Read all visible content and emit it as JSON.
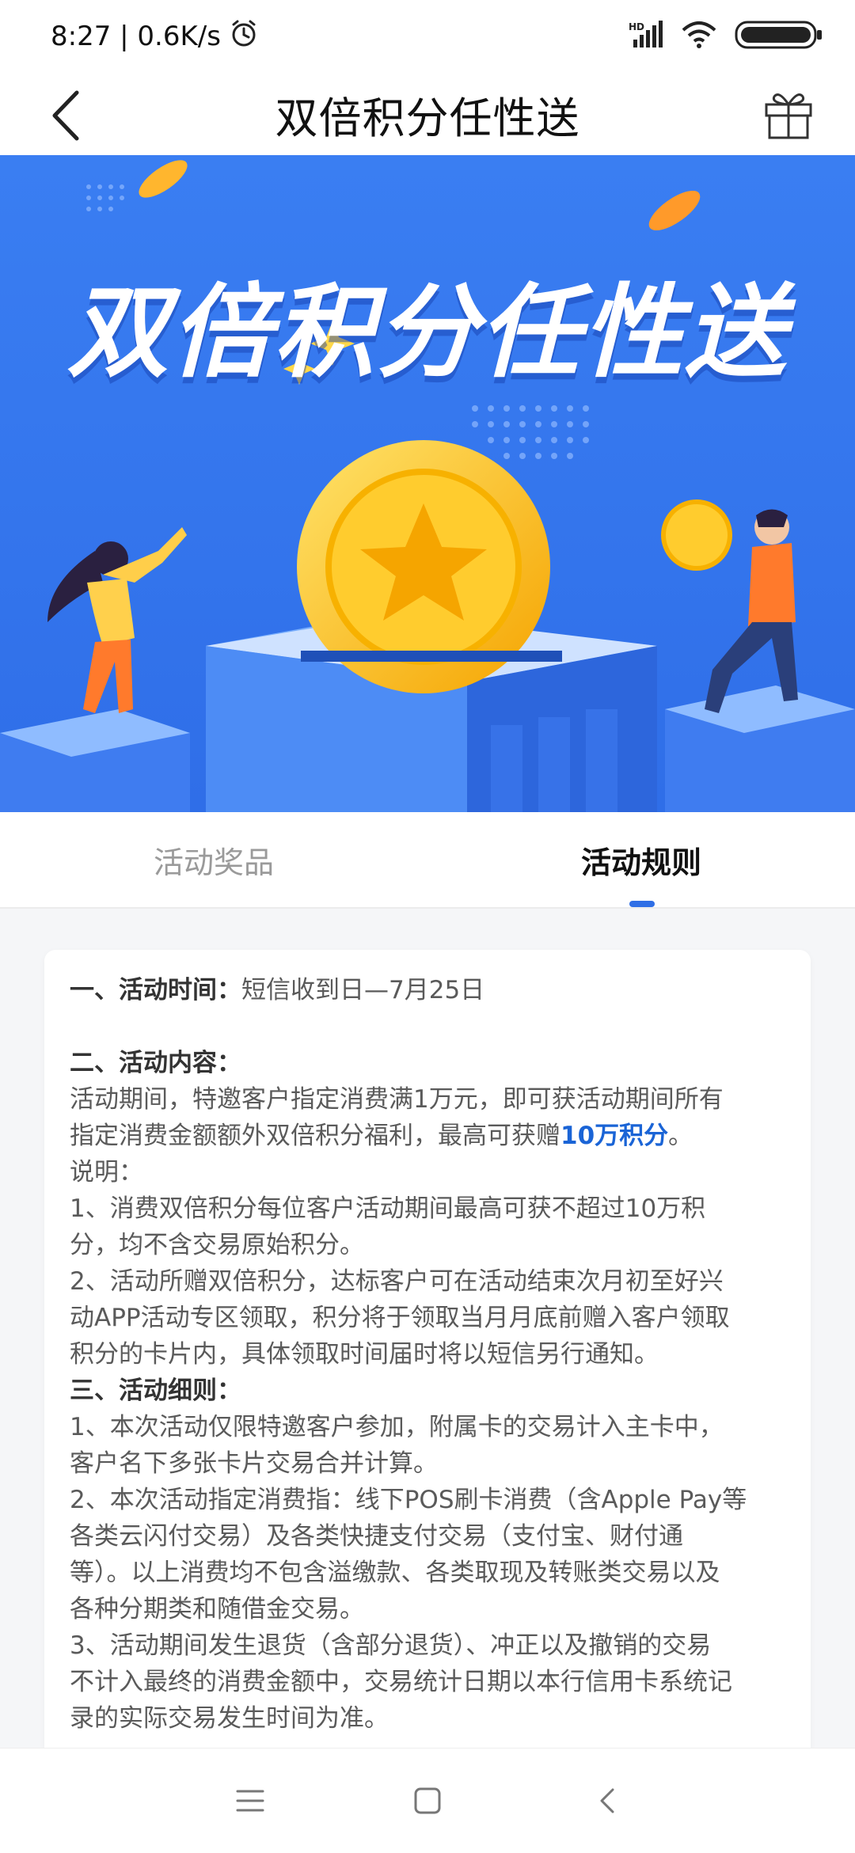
{
  "status": {
    "time_speed": "8:27 | 0.6K/s",
    "icons": [
      "alarm-icon",
      "signal-hd-icon",
      "wifi-icon",
      "battery-icon"
    ]
  },
  "nav": {
    "title": "双倍积分任性送",
    "back_icon": "chevron-left-icon",
    "gift_icon": "gift-icon"
  },
  "banner": {
    "title": "双倍积分任性送"
  },
  "tabs": [
    {
      "label": "活动奖品",
      "active": false
    },
    {
      "label": "活动规则",
      "active": true
    }
  ],
  "rules": {
    "time_head": "一、活动时间：",
    "time_value": "短信收到日—7月25日",
    "content_head": "二、活动内容：",
    "content_line1": "活动期间，特邀客户指定消费满1万元，即可获活动期间所有",
    "content_line2_prefix": "指定消费金额额外双倍积分福利，最高可获赠",
    "content_highlight": "10万积分",
    "content_line2_suffix": "。",
    "note_label": "说明：",
    "note1_line1": "1、消费双倍积分每位客户活动期间最高可获不超过10万积",
    "note1_line2": "分，均不含交易原始积分。",
    "note2_line1": "2、活动所赠双倍积分，达标客户可在活动结束次月初至好兴",
    "note2_line2": "动APP活动专区领取，积分将于领取当月月底前赠入客户领取",
    "note2_line3": "积分的卡片内，具体领取时间届时将以短信另行通知。",
    "details_head": "三、活动细则：",
    "d1_line1": "1、本次活动仅限特邀客户参加，附属卡的交易计入主卡中，",
    "d1_line2": "客户名下多张卡片交易合并计算。",
    "d2_line1": "2、本次活动指定消费指：线下POS刷卡消费（含Apple Pay等",
    "d2_line2": "各类云闪付交易）及各类快捷支付交易（支付宝、财付通",
    "d2_line3": "等）。以上消费均不包含溢缴款、各类取现及转账类交易以及",
    "d2_line4": "各种分期类和随借金交易。",
    "d3_line1": "3、活动期间发生退货（含部分退货）、冲正以及撤销的交易",
    "d3_line2": "不计入最终的消费金额中，交易统计日期以本行信用卡系统记",
    "d3_line3": "录的实际交易发生时间为准。"
  },
  "colors": {
    "accent": "#2f6fe6",
    "highlight": "#1a64d6",
    "banner_bg": "#3d7ef0"
  },
  "system_nav": [
    "menu-icon",
    "home-square-icon",
    "back-triangle-icon"
  ]
}
